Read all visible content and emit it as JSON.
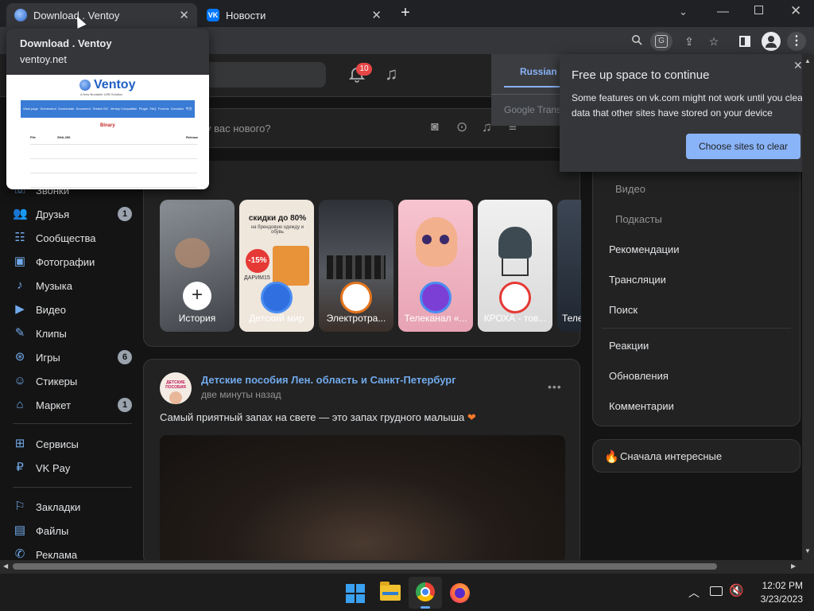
{
  "browser": {
    "tabs": [
      {
        "title": "Download . Ventoy",
        "active": true
      },
      {
        "title": "Новости",
        "active": false
      }
    ],
    "hovercard": {
      "title": "Download . Ventoy",
      "domain": "ventoy.net",
      "thumb_logo": "Ventoy",
      "thumb_tagline": "A New Bootable USB Solution",
      "thumb_menu": [
        "Main page",
        "Screenshot",
        "Downloads",
        "Document",
        "Tested ISO",
        "Ventoy Compatible",
        "Plugin",
        "FAQ",
        "Forums",
        "Donation",
        "中文"
      ],
      "thumb_heading": "Binary",
      "thumb_cols": [
        "File",
        "SHA-256",
        "Release"
      ]
    }
  },
  "translate": {
    "language": "Russian",
    "placeholder": "Google Trans"
  },
  "storage_popup": {
    "title": "Free up space to continue",
    "body": "Some features on vk.com might not work until you clear data that other sites have stored on your device",
    "button": "Choose sites to clear"
  },
  "vk": {
    "notification_count": "10",
    "post_input_placeholder": "у вас нового?",
    "sidebar": [
      {
        "label": "Звонки",
        "icon": "phone-icon",
        "badge": ""
      },
      {
        "label": "Друзья",
        "icon": "friends-icon",
        "badge": "1"
      },
      {
        "label": "Сообщества",
        "icon": "communities-icon",
        "badge": ""
      },
      {
        "label": "Фотографии",
        "icon": "photos-icon",
        "badge": ""
      },
      {
        "label": "Музыка",
        "icon": "music-icon",
        "badge": ""
      },
      {
        "label": "Видео",
        "icon": "video-icon",
        "badge": ""
      },
      {
        "label": "Клипы",
        "icon": "clips-icon",
        "badge": ""
      },
      {
        "label": "Игры",
        "icon": "games-icon",
        "badge": "6"
      },
      {
        "label": "Стикеры",
        "icon": "stickers-icon",
        "badge": ""
      },
      {
        "label": "Маркет",
        "icon": "market-icon",
        "badge": "1"
      },
      {
        "label": "Сервисы",
        "icon": "services-icon",
        "badge": ""
      },
      {
        "label": "VK Pay",
        "icon": "vkpay-icon",
        "badge": ""
      },
      {
        "label": "Закладки",
        "icon": "bookmarks-icon",
        "badge": ""
      },
      {
        "label": "Файлы",
        "icon": "files-icon",
        "badge": ""
      },
      {
        "label": "Реклама",
        "icon": "ads-icon",
        "badge": ""
      }
    ],
    "stories": [
      {
        "label": "История"
      },
      {
        "label": "Детский мир",
        "banner": "скидки до 80%",
        "sub": "на брендовую одежду и обувь",
        "badge": "-15%",
        "code": "ДАРИМ15"
      },
      {
        "label": "Электротра..."
      },
      {
        "label": "Телеканал «..."
      },
      {
        "label": "КРОХА - тов..."
      },
      {
        "label": "Теле"
      }
    ],
    "post": {
      "author": "Детские пособия Лен. область и Санкт-Петербург",
      "time": "две минуты назад",
      "text": "Самый приятный запах на свете — это запах грудного малыша",
      "avatar_text": "ДЕТСКИЕ ПОСОБИЯ"
    },
    "right_nav": {
      "sub_items": [
        "Видео",
        "Подкасты"
      ],
      "items": [
        "Рекомендации",
        "Трансляции",
        "Поиск"
      ],
      "items2": [
        "Реакции",
        "Обновления",
        "Комментарии"
      ],
      "sort": "Сначала интересные"
    }
  },
  "taskbar": {
    "time": "12:02 PM",
    "date": "3/23/2023"
  }
}
